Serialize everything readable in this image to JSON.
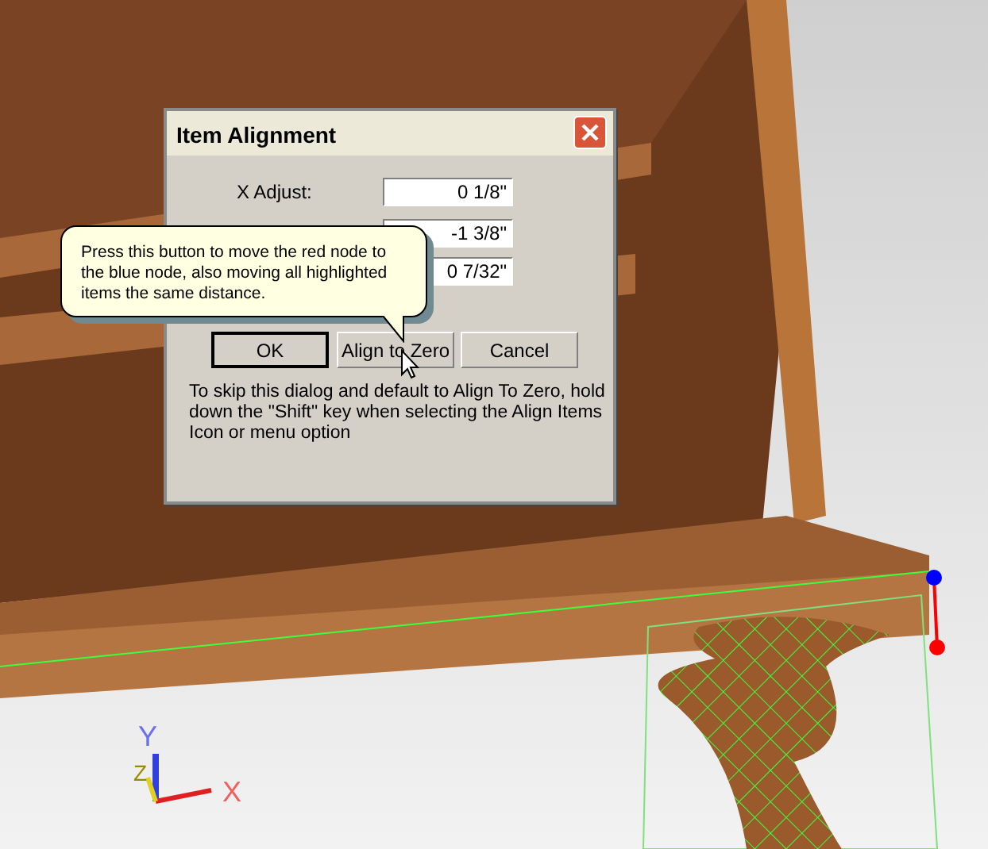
{
  "dialog": {
    "title": "Item Alignment",
    "fields": [
      {
        "label": "X Adjust:",
        "value": "0 1/8\""
      },
      {
        "value": "-1 3/8\""
      },
      {
        "value": "0 7/32\""
      }
    ],
    "buttons": [
      {
        "label": "OK",
        "default": true
      },
      {
        "label": "Align to Zero",
        "default": false
      },
      {
        "label": "Cancel",
        "default": false
      }
    ],
    "note": "To skip this dialog and default to Align To Zero, hold down the \"Shift\" key when selecting the Align Items Icon or menu option"
  },
  "tooltip": {
    "text": "Press this button to move the red node to the blue node, also moving all highlighted items the same distance."
  },
  "axes": {
    "y": "Y",
    "z": "Z",
    "x": "X"
  }
}
